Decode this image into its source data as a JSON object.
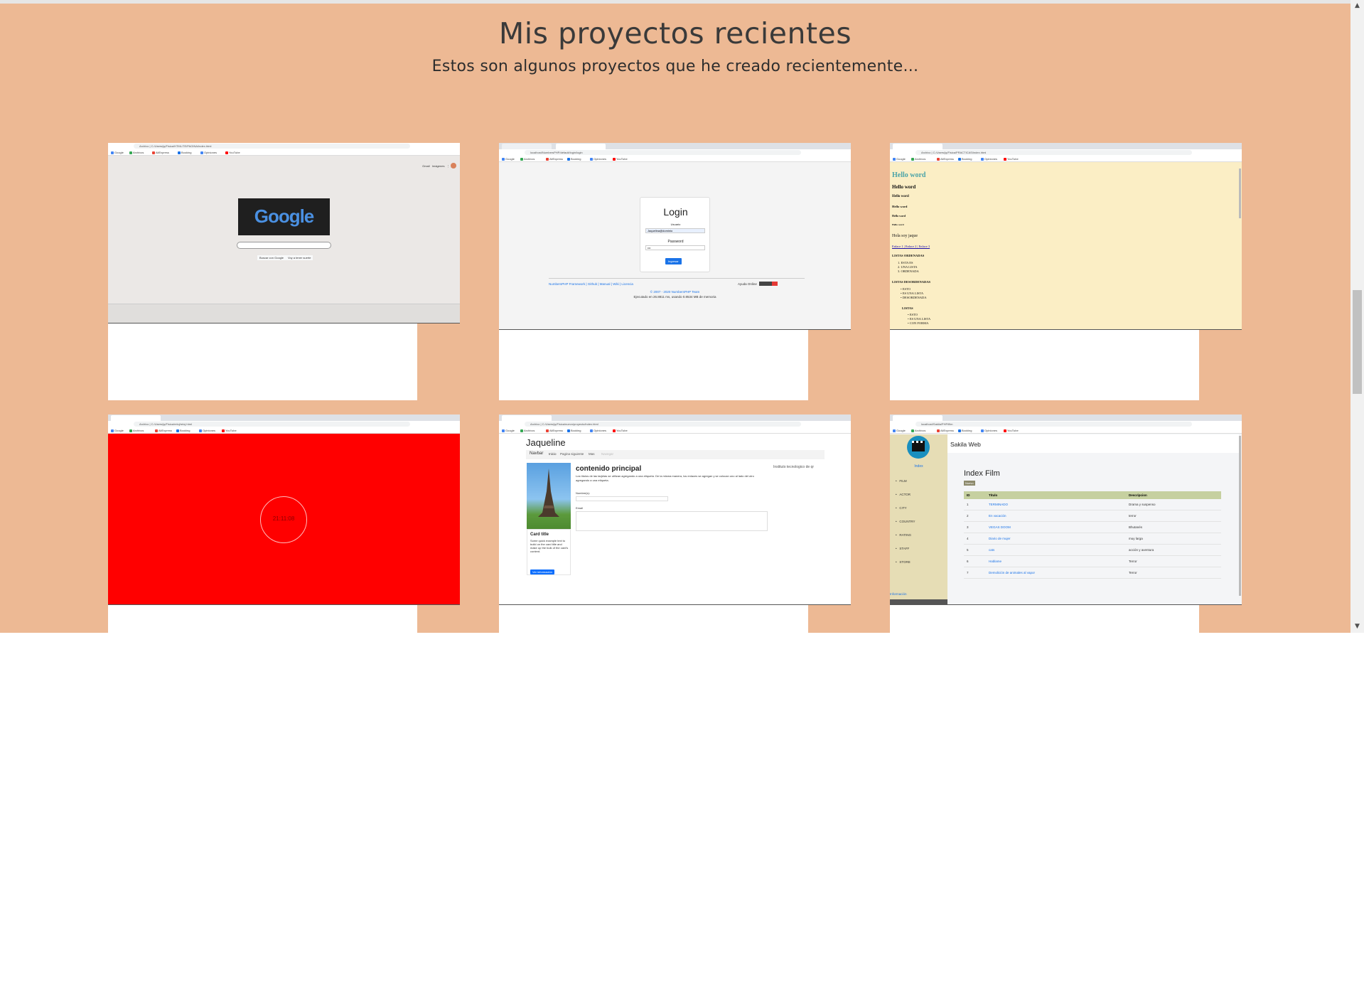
{
  "header": {
    "title": "Mis proyectos recientes",
    "subtitle": "Estos son algunos proyectos que he creado recientemente..."
  },
  "colors": {
    "section_bg": "#edb994",
    "page_bg": "#ffffff"
  },
  "projects": [
    {
      "kind": "google",
      "url": "Archivo | C:/Users/jq/Fisica/HTML/TE/PAGINA/index.html",
      "logo": "Google",
      "buttons": [
        "Buscar con Google",
        "Voy a tener suerte"
      ]
    },
    {
      "kind": "login",
      "url": "localhost/NumbersPHP/default/login/login",
      "heading": "Login",
      "user_label": "Usuario",
      "user_value": "Jaquelina@dominio",
      "pass_label": "Password",
      "pass_value": "•••",
      "submit": "Ingresar",
      "footer_links": "NumbersPHP Framework | Github | Manual | Wiki | Licencia",
      "footer_right": "Ayuda Online",
      "copyright": "© 2007 - 2020 NumbersPHP Team",
      "exec": "Ejecutado en 26.8811 ms, usando 0.8534 MB de memoria"
    },
    {
      "kind": "hello",
      "url": "Archivo | C:/Users/jq/Fisica/PRACTICAS/index.html",
      "lines": [
        "Hello word",
        "Hello word",
        "Hello word",
        "Hello word",
        "Hello word",
        "Hello word"
      ],
      "intro": "Hola soy jaque",
      "links": "Enlace 1 | Enlace 2 | Enlace 3",
      "ol_title": "LISTAS ORDENADAS",
      "ol": [
        "ESTA ES",
        "UNA LISTA",
        "ORDENADA"
      ],
      "ul_title": "LISTAS DESORDENADAS",
      "ul": [
        "ESTO",
        "ES UNA LISTA",
        "DESORDENADA"
      ],
      "nested_title": "LISTAS",
      "nested": [
        "ESTO",
        "ES UNA LISTA",
        "CON FORMA"
      ]
    },
    {
      "kind": "clock",
      "url": "Archivo | C:/Users/jq/Fisica/reloj/reloj.html",
      "time": "21:11:08"
    },
    {
      "kind": "bootstrap",
      "url": "Archivo | C:/Users/jq/Fisica/nuevo/proyecto/index.html",
      "brand": "Jaqueline",
      "nav": [
        "Navbar",
        "Inicio",
        "Pagina siguiente",
        "Mas",
        "Navegar"
      ],
      "main_title": "contenido principal",
      "main_text": "Los títulos de las tarjetas se utilizan agregando a una etiqueta. De la misma manera, los enlaces se agregan y se colocan uno al lado del otro agregando a una etiqueta.",
      "field1": "Nombre(s):",
      "field2": "Email",
      "aside": "Instituto tecnologico de qr",
      "card_title": "Card title",
      "card_text": "Some quick example text to build on the card title and make up the bulk of the card's content.",
      "card_btn": "Ver información"
    },
    {
      "kind": "sakila",
      "url": "localhost/Sakila/PHP/film",
      "app": "Sakila Web",
      "heading": "Index Film",
      "badge": "Nuevo",
      "menu_top": "Index",
      "menu": [
        "FILM",
        "ACTOR",
        "CITY",
        "COUNTRY",
        "RATING",
        "STAFF",
        "STORE"
      ],
      "menu_bottom": "Información",
      "columns": [
        "ID",
        "Título",
        "Descripcion"
      ],
      "rows": [
        [
          "1",
          "TERMINADO",
          "Drama y suspenso"
        ],
        [
          "2",
          "En vacación",
          "terror"
        ],
        [
          "3",
          "VEGAS DOOM",
          "Bhutanés"
        ],
        [
          "4",
          "Diario de mujer",
          "muy larga"
        ],
        [
          "5",
          "cats",
          "acción y aventura"
        ],
        [
          "6",
          "Hablame",
          "Terror"
        ],
        [
          "7",
          "Demolición de animales al vapor",
          "Terror"
        ]
      ]
    }
  ]
}
